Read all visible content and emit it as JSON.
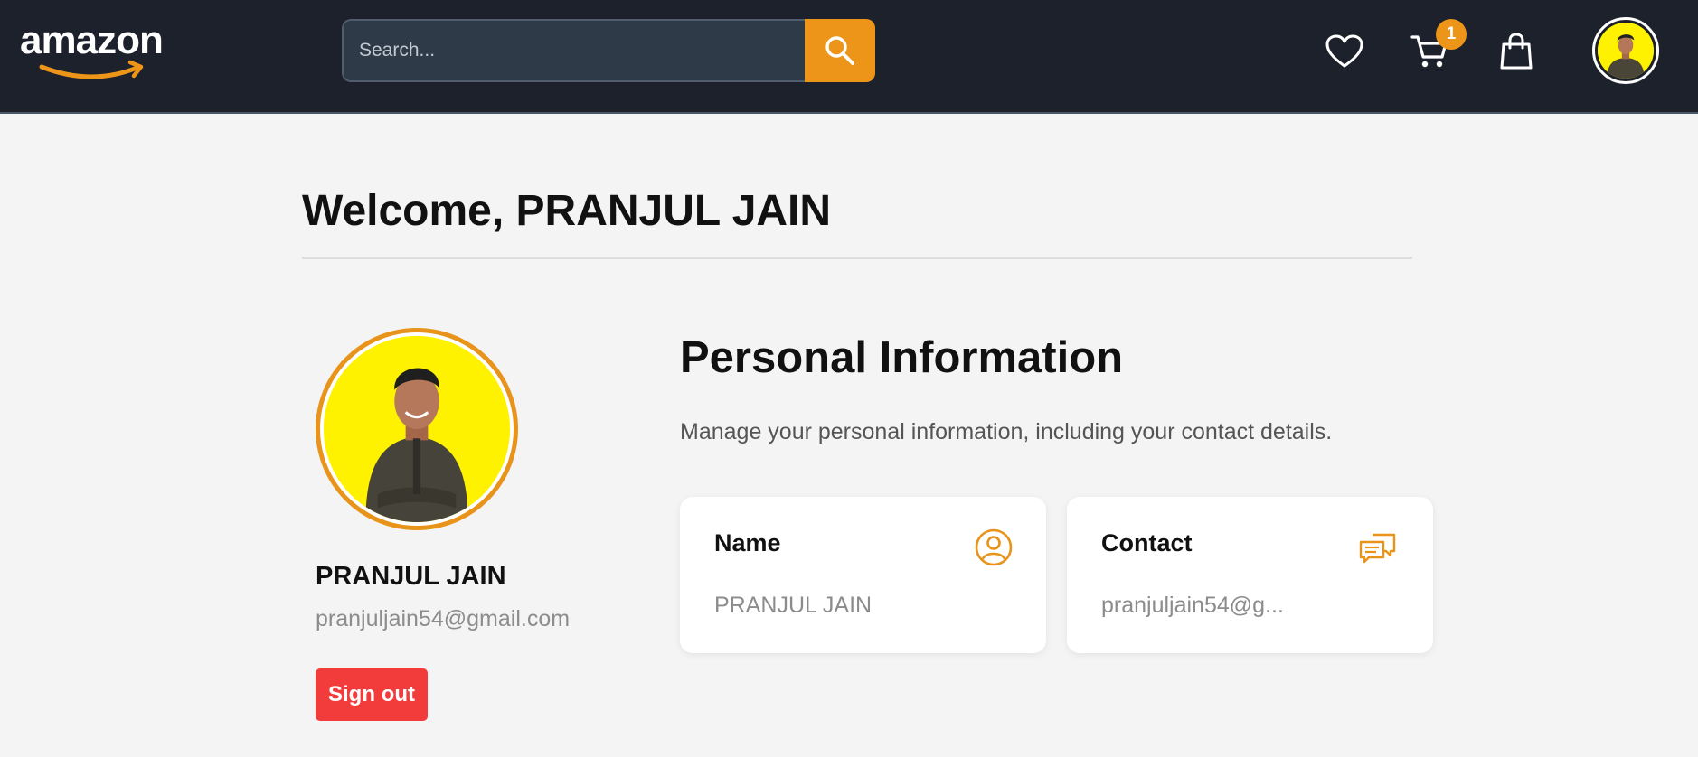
{
  "header": {
    "logo_text": "amazon",
    "search_placeholder": "Search...",
    "cart_count": "1",
    "colors": {
      "background": "#1d212b",
      "accent": "#ec9518"
    },
    "icons": [
      "search-icon",
      "heart-icon",
      "cart-icon",
      "shopping-bag-icon",
      "avatar"
    ]
  },
  "main": {
    "welcome_title": "Welcome, PRANJUL JAIN",
    "profile": {
      "name": "PRANJUL JAIN",
      "email": "pranjuljain54@gmail.com",
      "signout_label": "Sign out"
    },
    "personal_info": {
      "title": "Personal Information",
      "description": "Manage your personal information, including your contact details.",
      "cards": [
        {
          "label": "Name",
          "value": "PRANJUL JAIN",
          "icon": "user-circle-icon"
        },
        {
          "label": "Contact",
          "value": "pranjuljain54@g...",
          "icon": "chat-bubbles-icon"
        }
      ]
    },
    "colors": {
      "signout": "#f23c3c",
      "avatar_ring": "#e8941a"
    }
  }
}
